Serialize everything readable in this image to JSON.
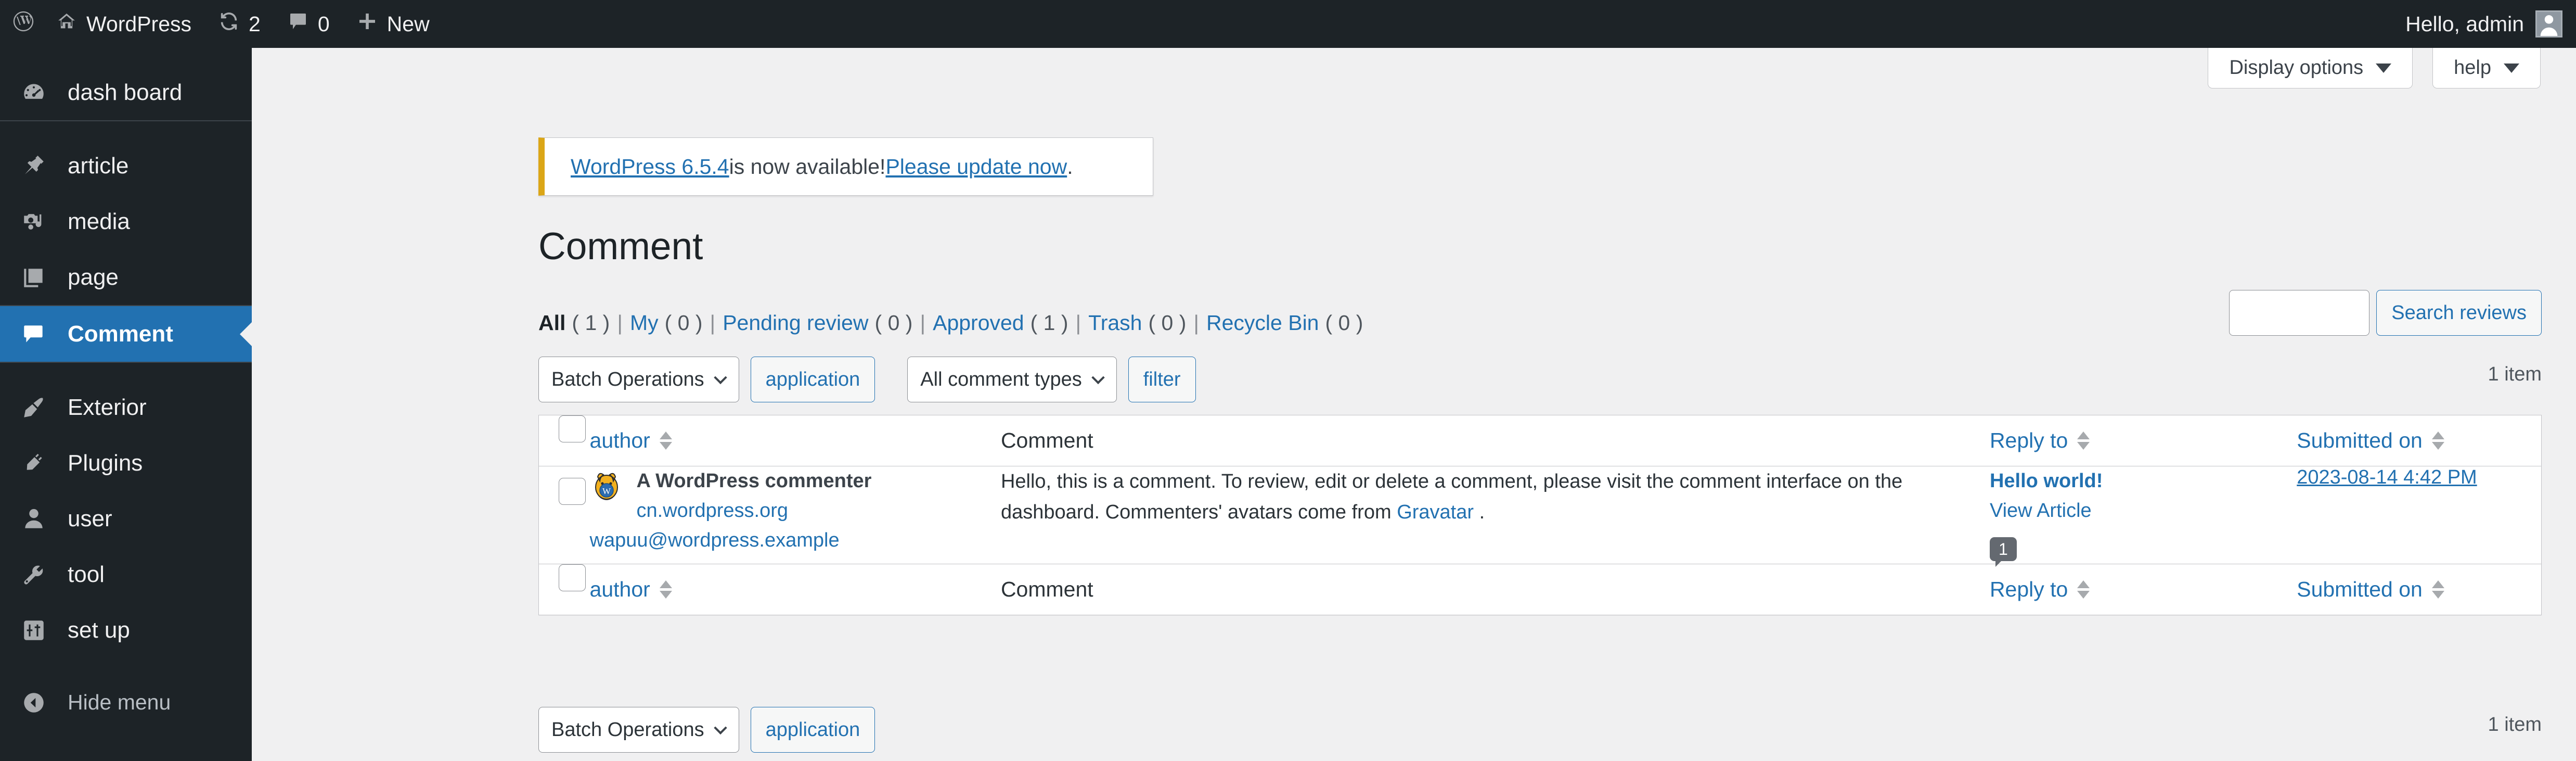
{
  "adminbar": {
    "wp_logo": "wordpress-logo-icon",
    "site_name": "WordPress",
    "updates_icon": "updates-icon",
    "updates_count": "2",
    "comments_icon": "comment-bubble-icon",
    "comments_count": "0",
    "new_icon": "plus-icon",
    "new_label": "New",
    "greeting": "Hello, admin",
    "avatar": "user-avatar"
  },
  "sidebar": {
    "items": [
      {
        "label": "dash board",
        "icon": "dashboard-icon",
        "active": false
      },
      {
        "label": "article",
        "icon": "pin-icon",
        "active": false
      },
      {
        "label": "media",
        "icon": "media-icon",
        "active": false
      },
      {
        "label": "page",
        "icon": "pages-icon",
        "active": false
      },
      {
        "label": "Comment",
        "icon": "comment-icon",
        "active": true
      },
      {
        "label": "Exterior",
        "icon": "paintbrush-icon",
        "active": false
      },
      {
        "label": "Plugins",
        "icon": "plug-icon",
        "active": false
      },
      {
        "label": "user",
        "icon": "user-icon",
        "active": false
      },
      {
        "label": "tool",
        "icon": "wrench-icon",
        "active": false
      },
      {
        "label": "set up",
        "icon": "settings-sliders-icon",
        "active": false
      }
    ],
    "collapse": {
      "label": "Hide menu",
      "icon": "collapse-arrow-icon"
    }
  },
  "screen_meta": {
    "display_options": "Display options",
    "help": "help"
  },
  "notice": {
    "link_version": "WordPress 6.5.4",
    "middle": " is now available! ",
    "link_update": "Please update now",
    "trailing": " ."
  },
  "page": {
    "title": "Comment"
  },
  "filters": [
    {
      "label": "All",
      "count": "( 1 )",
      "current": true
    },
    {
      "label": "My",
      "count": "( 0 )",
      "current": false
    },
    {
      "label": "Pending review",
      "count": "( 0 )",
      "current": false
    },
    {
      "label": "Approved",
      "count": "( 1 )",
      "current": false
    },
    {
      "label": "Trash",
      "count": "( 0 )",
      "current": false
    },
    {
      "label": "Recycle Bin",
      "count": "( 0 )",
      "current": false
    }
  ],
  "search": {
    "value": "",
    "placeholder": "",
    "button": "Search reviews"
  },
  "tablenav": {
    "bulk_select": "Batch Operations",
    "bulk_apply": "application",
    "type_select": "All comment types",
    "filter_button": "filter",
    "count_top": "1 item",
    "count_bottom": "1 item"
  },
  "table": {
    "columns": {
      "author": "author",
      "comment": "Comment",
      "reply_to": "Reply to",
      "submitted_on": "Submitted on"
    },
    "rows": [
      {
        "author_name": "A WordPress commenter",
        "author_site": "cn.wordpress.org",
        "author_email": "wapuu@wordpress.example",
        "avatar": "wapuu-avatar",
        "comment_part1": "Hello, this is a comment. To review, edit or delete a comment, please visit the comment interface on the dashboard. Commenters' avatars come from ",
        "comment_link": "Gravatar",
        "comment_part2": " .",
        "reply_post": "Hello world!",
        "reply_view": "View Article",
        "reply_count": "1",
        "submitted_on": "2023-08-14 4:42 PM"
      }
    ]
  },
  "colors": {
    "admin_dark": "#1d2327",
    "accent_blue": "#2271b1",
    "page_bg": "#f0f0f1",
    "notice_gold": "#dba617",
    "bubble_gray": "#646970"
  }
}
